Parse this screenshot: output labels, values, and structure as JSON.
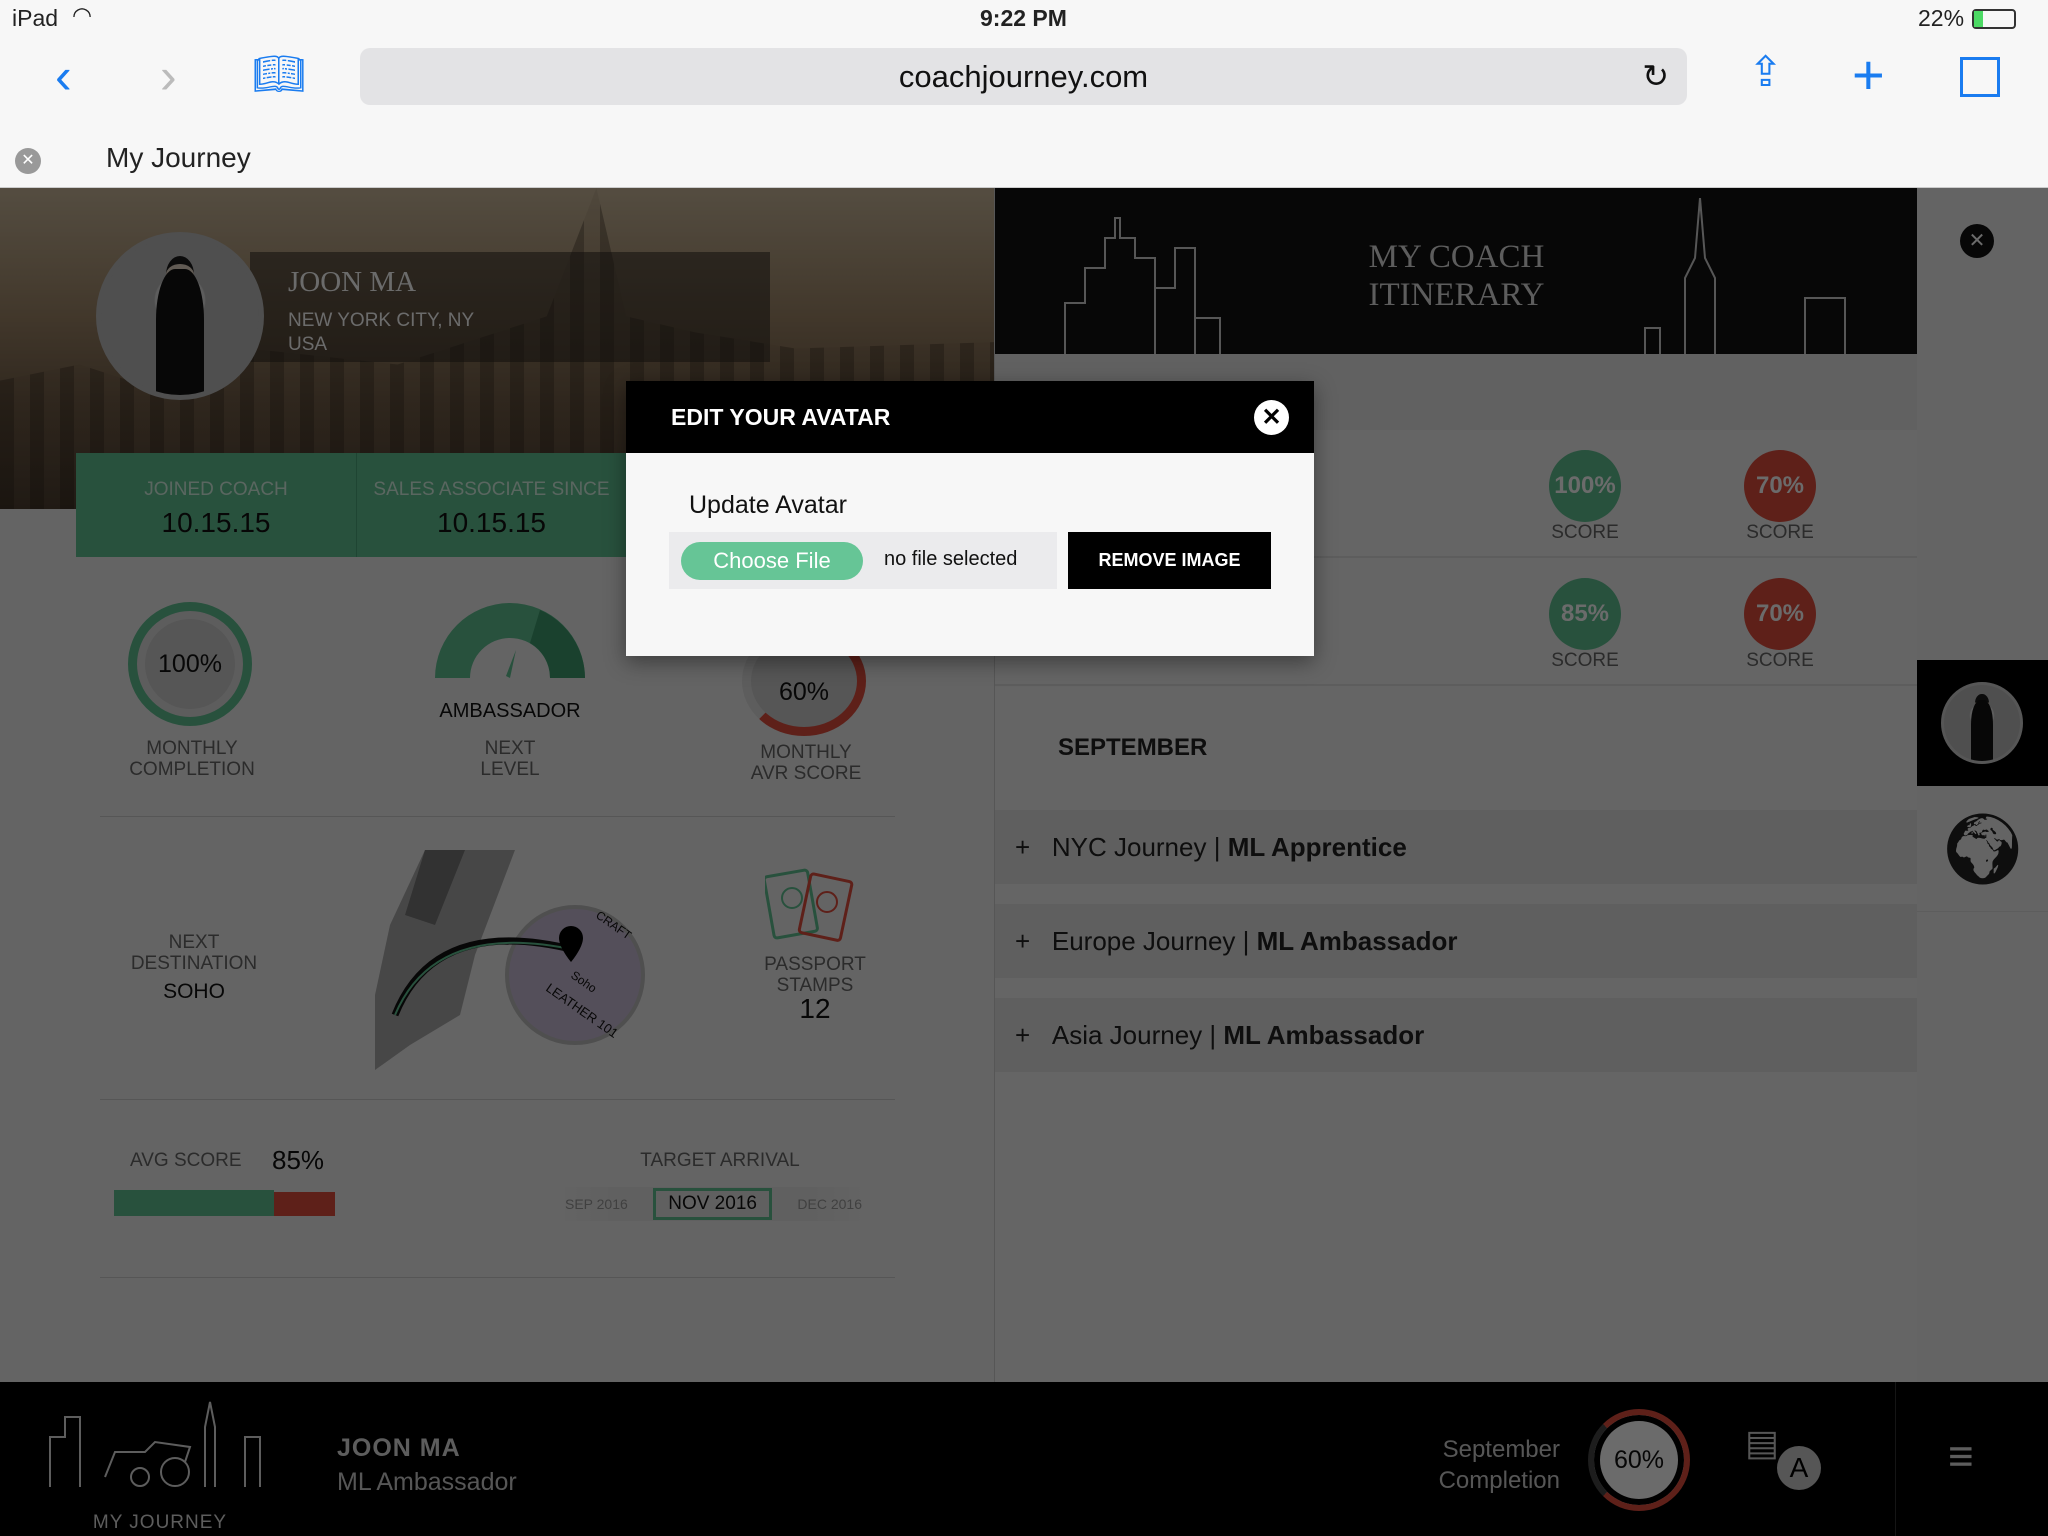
{
  "status": {
    "device": "iPad",
    "time": "9:22 PM",
    "battery": "22%"
  },
  "browser": {
    "url": "coachjourney.com",
    "tab_title": "My Journey"
  },
  "profile": {
    "name": "JOON MA",
    "city": "NEW YORK CITY, NY",
    "country": "USA",
    "joined_label": "JOINED COACH",
    "joined_value": "10.15.15",
    "since_label": "SALES ASSOCIATE SINCE",
    "since_value": "10.15.15"
  },
  "metrics": {
    "completion_value": "100%",
    "completion_label1": "MONTHLY",
    "completion_label2": "COMPLETION",
    "level_name": "AMBASSADOR",
    "level_label1": "NEXT",
    "level_label2": "LEVEL",
    "avr_value": "60%",
    "avr_label1": "MONTHLY",
    "avr_label2": "AVR SCORE",
    "avr_fraction": 0.6
  },
  "destination": {
    "label1": "NEXT",
    "label2": "DESTINATION",
    "value": "SOHO",
    "map_pin": "Soho",
    "map_store": "LEATHER 101",
    "map_street": "CRAFT"
  },
  "passport": {
    "label1": "PASSPORT",
    "label2": "STAMPS",
    "value": "12"
  },
  "avg": {
    "label": "AVG SCORE",
    "value": "85%",
    "fraction": 0.85
  },
  "target": {
    "label": "TARGET ARRIVAL",
    "months": [
      "SEP 2016",
      "NOV 2016",
      "DEC 2016"
    ],
    "selected": "NOV 2016"
  },
  "itinerary": {
    "title1": "MY COACH",
    "title2": "ITINERARY",
    "scores": [
      {
        "value": "100%",
        "label": "SCORE",
        "color": "#5fc091"
      },
      {
        "value": "70%",
        "label": "SCORE",
        "color": "#e04b3c"
      },
      {
        "value": "85%",
        "label": "SCORE",
        "color": "#5fc091"
      },
      {
        "value": "70%",
        "label": "SCORE",
        "color": "#e04b3c"
      }
    ],
    "month": "SEPTEMBER",
    "journeys": [
      {
        "name": "NYC Journey",
        "level": "ML Apprentice"
      },
      {
        "name": "Europe Journey",
        "level": "ML Ambassador"
      },
      {
        "name": "Asia Journey",
        "level": "ML Ambassador"
      }
    ]
  },
  "footer": {
    "logo_text": "MY JOURNEY",
    "name": "JOON MA",
    "title": "ML Ambassador",
    "completion_label1": "September",
    "completion_label2": "Completion",
    "completion_value": "60%",
    "completion_fraction": 0.6
  },
  "modal": {
    "title": "EDIT YOUR AVATAR",
    "subtitle": "Update Avatar",
    "choose_label": "Choose File",
    "file_status": "no file selected",
    "remove_label": "REMOVE IMAGE"
  },
  "colors": {
    "green": "#5fc091",
    "red": "#e04b3c",
    "ios_blue": "#1a7cf0"
  }
}
